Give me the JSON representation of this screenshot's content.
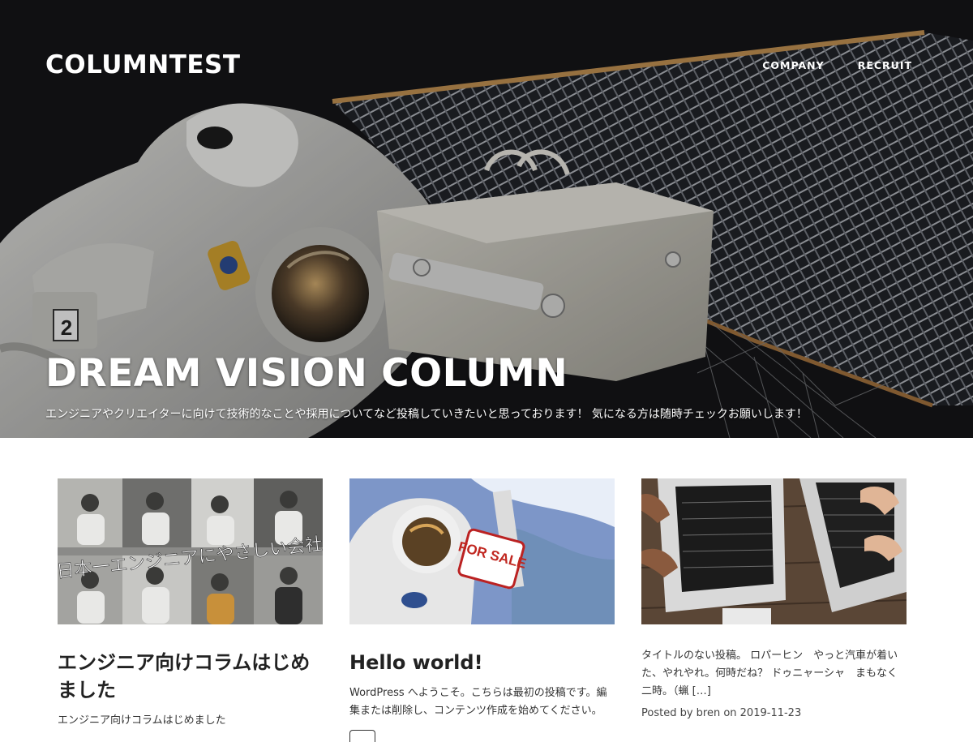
{
  "site": {
    "title": "COLUMNTEST"
  },
  "nav": {
    "items": [
      {
        "label": "COMPANY"
      },
      {
        "label": "RECRUIT"
      }
    ]
  },
  "hero": {
    "heading": "DREAM VISION COLUMN",
    "tagline": "エンジニアやクリエイターに向けて技術的なことや採用についてなど投稿していきたいと思っております！ 気になる方は随時チェックお願いします！",
    "image_overlay_text": "2"
  },
  "posts": [
    {
      "image_overlay_text": "日本一エンジニアにやさしい会社",
      "title": "エンジニア向けコラムはじめました",
      "excerpt": "エンジニア向けコラムはじめました"
    },
    {
      "image_overlay_text": "FOR SALE",
      "title": "Hello world!",
      "excerpt": "WordPress へようこそ。こちらは最初の投稿です。編集または削除し、コンテンツ作成を始めてください。"
    },
    {
      "excerpt": "タイトルのない投稿。 ロパーヒン　やっと汽車が着いた、やれやれ。何時だね？ ドゥニャーシャ　まもなく二時。（蝋 […]",
      "meta": "Posted by bren on 2019-11-23"
    }
  ]
}
